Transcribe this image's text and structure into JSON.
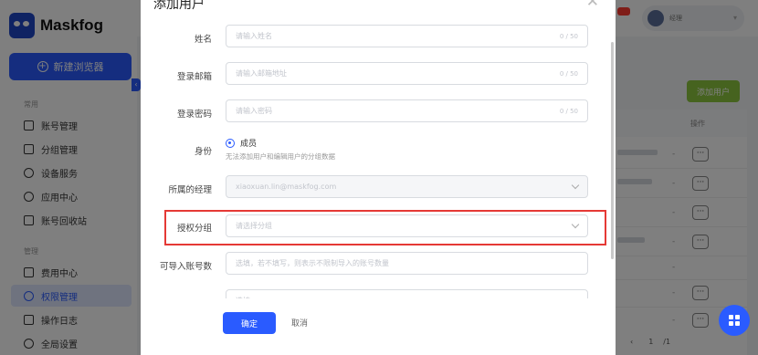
{
  "app": {
    "logo_text": "Maskfog",
    "new_browser_label": "新建浏览器",
    "sections": {
      "common": "常用",
      "manage": "管理"
    },
    "nav_common": [
      "账号管理",
      "分组管理",
      "设备服务",
      "应用中心",
      "账号回收站"
    ],
    "nav_manage": [
      "费用中心",
      "权限管理",
      "操作日志",
      "全局设置"
    ],
    "active_item": "权限管理",
    "user": {
      "role": "经理"
    },
    "add_user_button": "添加用户",
    "table": {
      "ops_header": "操作",
      "row_op_label": "···",
      "empty_cell": "-"
    },
    "pager": {
      "current": "1",
      "total": "/1"
    }
  },
  "modal": {
    "title": "添加用户",
    "close_icon": "close-icon",
    "fields": {
      "name": {
        "label": "姓名",
        "placeholder": "请输入姓名",
        "counter": "0 / 50"
      },
      "email": {
        "label": "登录邮箱",
        "placeholder": "请输入邮箱地址",
        "counter": "0 / 50"
      },
      "password": {
        "label": "登录密码",
        "placeholder": "请输入密码",
        "counter": "0 / 50"
      },
      "role": {
        "label": "身份",
        "option": "成员",
        "help": "无法添加用户和编辑用户的分组数据"
      },
      "manager": {
        "label": "所属的经理",
        "value": "xiaoxuan.lin@maskfog.com"
      },
      "groups": {
        "label": "授权分组",
        "placeholder": "请选择分组"
      },
      "import_limit": {
        "label": "可导入账号数",
        "placeholder": "选填，若不填写，则表示不限制导入的账号数量"
      },
      "extra": {
        "placeholder": "选填"
      }
    },
    "ok_label": "确定",
    "cancel_label": "取消"
  },
  "colors": {
    "accent": "#2a5bff",
    "highlight": "#e53935",
    "add_user": "#8cc63f"
  }
}
